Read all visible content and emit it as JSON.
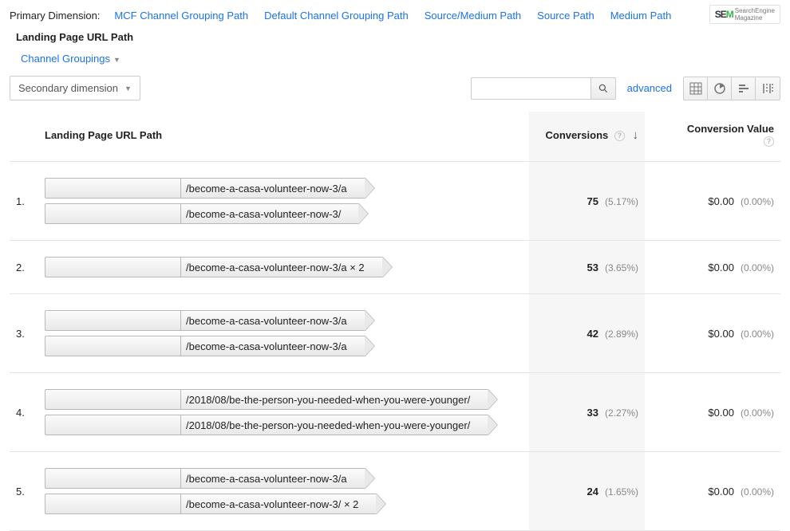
{
  "dimensions": {
    "label": "Primary Dimension:",
    "links": [
      "MCF Channel Grouping Path",
      "Default Channel Grouping Path",
      "Source/Medium Path",
      "Source Path",
      "Medium Path"
    ],
    "active": "Landing Page URL Path",
    "channel_groupings": "Channel Groupings"
  },
  "secondary_dimension_label": "Secondary dimension",
  "advanced_label": "advanced",
  "watermark": {
    "prefix": "SE",
    "suffix": "M",
    "sub1": "SearchEngine",
    "sub2": "Magazine"
  },
  "columns": {
    "path": "Landing Page URL Path",
    "conversions": "Conversions",
    "value": "Conversion Value"
  },
  "rows": [
    {
      "idx": "1.",
      "chips": [
        "/become-a-casa-volunteer-now-3/a",
        "/become-a-casa-volunteer-now-3/"
      ],
      "conversions": "75",
      "conv_pct": "(5.17%)",
      "value": "$0.00",
      "val_pct": "(0.00%)"
    },
    {
      "idx": "2.",
      "chips": [
        "/become-a-casa-volunteer-now-3/a × 2"
      ],
      "conversions": "53",
      "conv_pct": "(3.65%)",
      "value": "$0.00",
      "val_pct": "(0.00%)"
    },
    {
      "idx": "3.",
      "chips": [
        "/become-a-casa-volunteer-now-3/a",
        "/become-a-casa-volunteer-now-3/a"
      ],
      "conversions": "42",
      "conv_pct": "(2.89%)",
      "value": "$0.00",
      "val_pct": "(0.00%)"
    },
    {
      "idx": "4.",
      "chips": [
        "/2018/08/be-the-person-you-needed-when-you-were-younger/",
        "/2018/08/be-the-person-you-needed-when-you-were-younger/"
      ],
      "conversions": "33",
      "conv_pct": "(2.27%)",
      "value": "$0.00",
      "val_pct": "(0.00%)"
    },
    {
      "idx": "5.",
      "chips": [
        "/become-a-casa-volunteer-now-3/a",
        "/become-a-casa-volunteer-now-3/ × 2"
      ],
      "conversions": "24",
      "conv_pct": "(1.65%)",
      "value": "$0.00",
      "val_pct": "(0.00%)"
    }
  ]
}
